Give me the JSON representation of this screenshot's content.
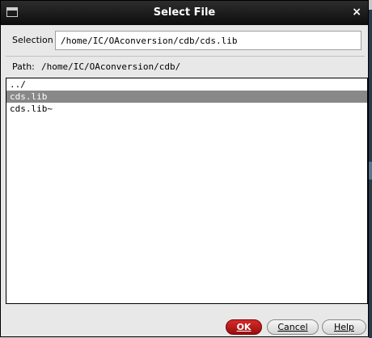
{
  "window": {
    "title": "Select File",
    "icon": "window-icon",
    "close_icon": "×"
  },
  "selection": {
    "label": "Selection",
    "value": "/home/IC/OAconversion/cdb/cds.lib"
  },
  "path": {
    "label": "Path:",
    "value": "/home/IC/OAconversion/cdb/"
  },
  "file_list": {
    "items": [
      "../",
      "cds.lib",
      "cds.lib~"
    ],
    "selected_index": 1
  },
  "buttons": {
    "ok": "OK",
    "cancel": "Cancel",
    "help": "Help"
  },
  "colors": {
    "title_bar": "#111111",
    "ok_button": "#b81a1a",
    "selected_row": "#888888"
  }
}
